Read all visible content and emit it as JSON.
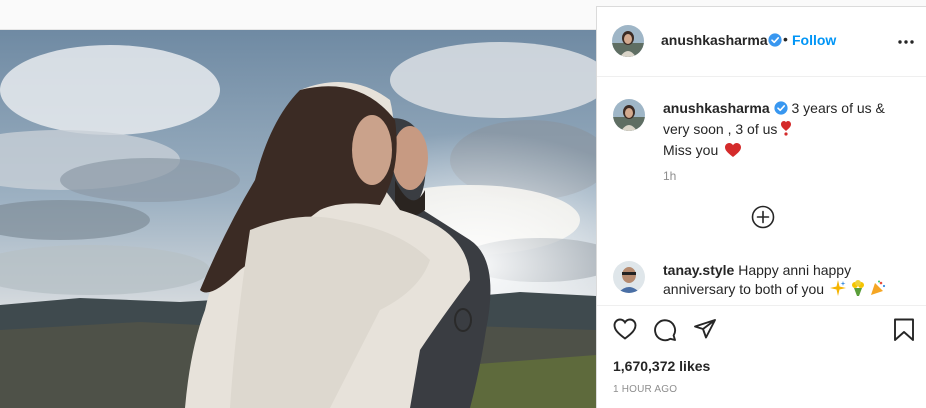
{
  "post": {
    "username": "anushkasharma",
    "follow_separator": "•",
    "follow_label": "Follow",
    "more_icon": "more-horizontal-icon",
    "caption_parts": [
      "3 years of us & very soon , 3 of us",
      "Miss you"
    ],
    "caption_time": "1h",
    "load_more_icon": "plus-circle-icon"
  },
  "comments": [
    {
      "username": "tanay.style",
      "text": "Happy anni happy anniversary to both of you"
    }
  ],
  "actions": {
    "like_icon": "heart-outline-icon",
    "comment_icon": "comment-bubble-icon",
    "share_icon": "paper-plane-icon",
    "save_icon": "bookmark-icon"
  },
  "stats": {
    "likes": "1,670,372 likes",
    "time_ago": "1 HOUR AGO"
  },
  "colors": {
    "link_blue": "#0095f6",
    "verified_blue": "#3897f0",
    "heart_red": "#ed4956",
    "muted_text": "#8e8e8e"
  }
}
